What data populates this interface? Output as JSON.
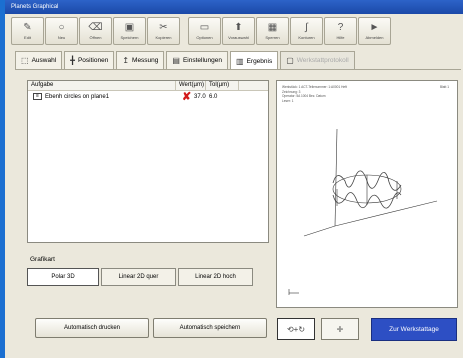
{
  "window": {
    "title": "Planets Graphical"
  },
  "toolbar": {
    "buttons": [
      {
        "icon": "pen-icon",
        "glyph": "✎",
        "label": "Edit"
      },
      {
        "icon": "circle-icon",
        "glyph": "○",
        "label": "Neu"
      },
      {
        "icon": "save-icon",
        "glyph": "⌫",
        "label": "Öffnen"
      },
      {
        "icon": "disk-icon",
        "glyph": "▣",
        "label": "Speichern"
      },
      {
        "icon": "scissors-icon",
        "glyph": "✂",
        "label": "Kopieren"
      },
      {
        "icon": "document-icon",
        "glyph": "▭",
        "label": "Optionen"
      },
      {
        "icon": "pin-icon",
        "glyph": "⬆",
        "label": "Vorauswahl"
      },
      {
        "icon": "grid-icon",
        "glyph": "▦",
        "label": "Sperren"
      },
      {
        "icon": "curve-icon",
        "glyph": "∫",
        "label": "Konturen"
      },
      {
        "icon": "help-icon",
        "glyph": "?",
        "label": "Hilfe"
      },
      {
        "icon": "play-icon",
        "glyph": "►",
        "label": "Abmelden"
      }
    ]
  },
  "tabs": [
    {
      "label": "Auswahl",
      "icon": "selection-icon",
      "glyph": "⬚",
      "active": false,
      "disabled": false
    },
    {
      "label": "Positionen",
      "icon": "position-icon",
      "glyph": "╋",
      "active": false,
      "disabled": false
    },
    {
      "label": "Messung",
      "icon": "measure-icon",
      "glyph": "↥",
      "active": false,
      "disabled": false
    },
    {
      "label": "Einstellungen",
      "icon": "settings-icon",
      "glyph": "▤",
      "active": false,
      "disabled": false
    },
    {
      "label": "Ergebnis",
      "icon": "result-icon",
      "glyph": "▥",
      "active": true,
      "disabled": false
    },
    {
      "label": "Werkstattprotokoll",
      "icon": "protocol-icon",
      "glyph": "▢",
      "active": false,
      "disabled": true
    }
  ],
  "task_table": {
    "headers": [
      "Aufgabe",
      "Wert(µm)",
      "Tol(µm)"
    ],
    "rows": [
      {
        "name": "Ebenh circles on plane1",
        "value": "37.0",
        "tolerance": "6.0",
        "status": "fail"
      }
    ]
  },
  "graphic": {
    "label": "Grafikart",
    "options": [
      "Polar 3D",
      "Linear 2D quer",
      "Linear 2D hoch"
    ],
    "selected": "Polar 3D"
  },
  "actions": {
    "print_label": "Automatisch drucken",
    "save_label": "Automatisch speichern",
    "workpiece_label": "Zur Werkstattage"
  },
  "preview": {
    "header_left": [
      "Werkstück: 1 ACT-Teilenummer: 1:A0001 Heft",
      "Zeichnung: 3",
      "Operator: 5A 1004 Bez. Datum",
      "Leser: 1"
    ],
    "header_right": "Blatt 1"
  },
  "nav_buttons": [
    {
      "icon": "rotate-icon",
      "glyph": "⟲+↻",
      "pressed": true
    },
    {
      "icon": "move-icon",
      "glyph": "✛",
      "pressed": false
    }
  ]
}
